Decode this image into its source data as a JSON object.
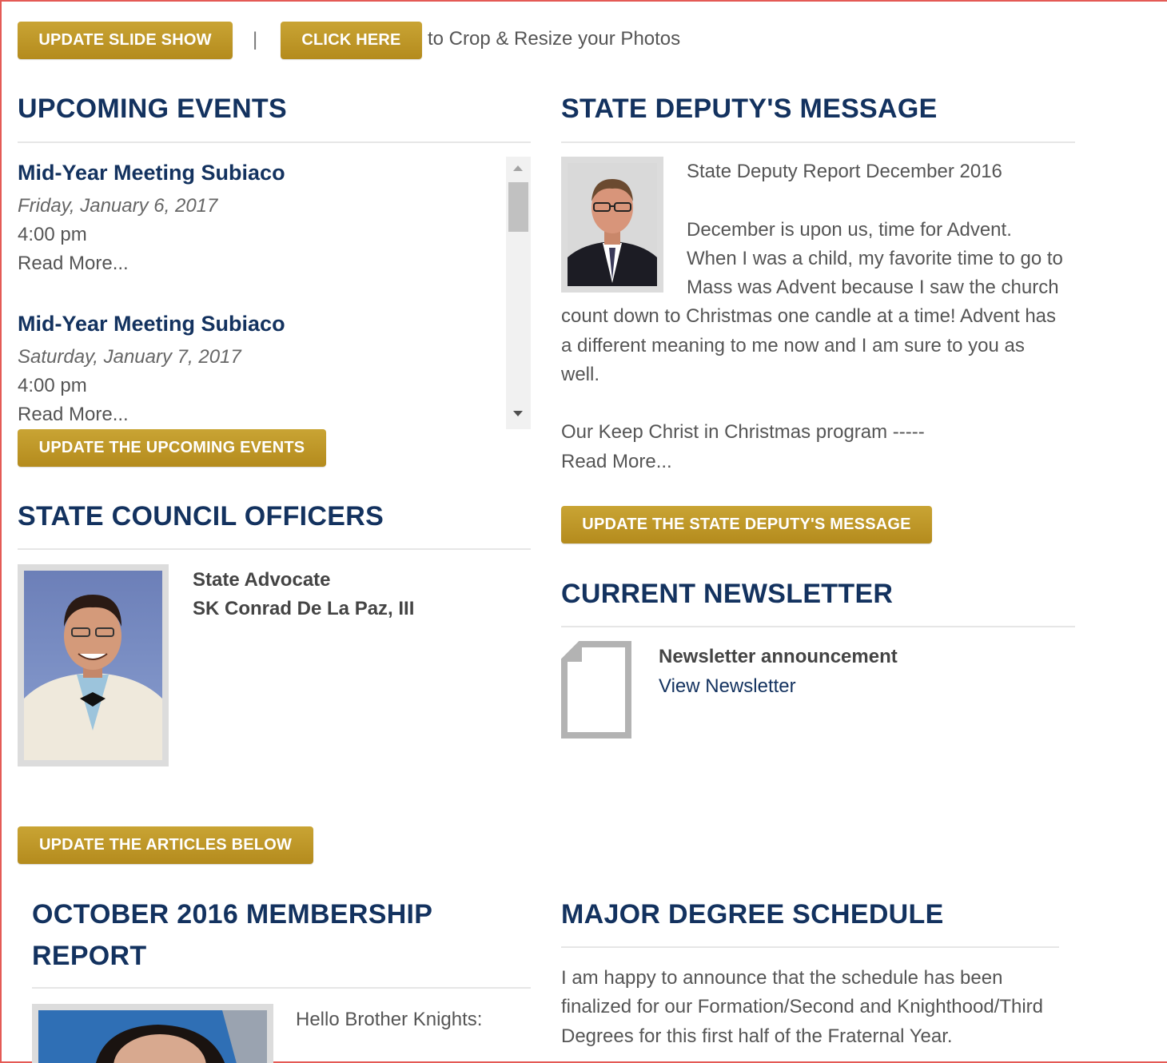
{
  "top_bar": {
    "slideshow_btn": "UPDATE SLIDE SHOW",
    "separator": "|",
    "click_here_btn": "CLICK HERE",
    "crop_text": "to Crop & Resize your Photos"
  },
  "events": {
    "heading": "UPCOMING EVENTS",
    "items": [
      {
        "title": "Mid-Year Meeting Subiaco",
        "date": "Friday, January 6, 2017",
        "time": "4:00 pm",
        "more": "Read More..."
      },
      {
        "title": "Mid-Year Meeting Subiaco",
        "date": "Saturday, January 7, 2017",
        "time": "4:00 pm",
        "more": "Read More..."
      }
    ],
    "update_btn": "UPDATE THE UPCOMING EVENTS"
  },
  "deputy": {
    "heading": "STATE DEPUTY'S MESSAGE",
    "report_title": "State Deputy Report December 2016",
    "para1_line1": "December is upon us, time for Advent.",
    "para1_line2": "When I was a child, my favorite time to go to",
    "para1_line3": "Mass was Advent because I saw the church",
    "para1_line4": "count down to Christmas one candle at a time! Advent has",
    "para1_line5": "a different meaning to me now and I am sure to you as",
    "para1_line6": "well.",
    "para2": "Our Keep Christ in Christmas program -----",
    "more": "Read More...",
    "update_btn": "UPDATE THE STATE DEPUTY'S MESSAGE"
  },
  "officers": {
    "heading": "STATE COUNCIL OFFICERS",
    "role": "State Advocate",
    "name": "SK Conrad De La Paz, III"
  },
  "newsletter": {
    "heading": "CURRENT NEWSLETTER",
    "announcement": "Newsletter announcement",
    "view_link": "View Newsletter"
  },
  "articles": {
    "update_btn": "UPDATE THE ARTICLES BELOW",
    "membership_heading_line1": "OCTOBER 2016 MEMBERSHIP",
    "membership_heading_line2": "REPORT",
    "membership_greeting": "Hello Brother Knights:",
    "degree_heading": "MAJOR DEGREE SCHEDULE",
    "degree_line1": "I am happy to announce that the schedule has been",
    "degree_line2": "finalized for our Formation/Second and Knighthood/Third",
    "degree_line3": "Degrees for this first half of the Fraternal Year."
  }
}
